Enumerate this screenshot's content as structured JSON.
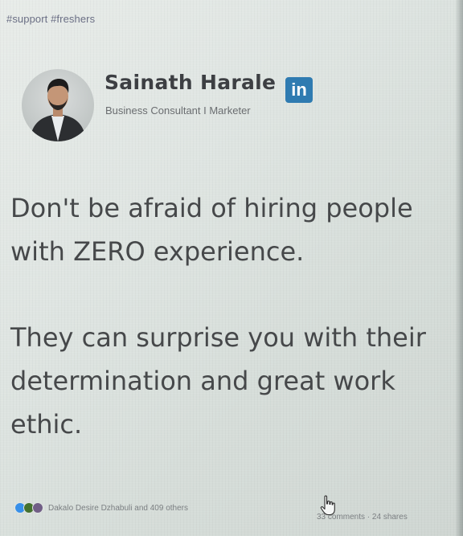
{
  "post": {
    "hashtags": "#support #freshers",
    "author": {
      "name": "Sainath Harale",
      "title": "Business Consultant I Marketer",
      "network_badge": "in"
    },
    "body": {
      "paragraph_1": "Don't be afraid of hiring people with ZERO experience.",
      "paragraph_2": "They can surprise you with their determination and great work ethic."
    },
    "reactions": {
      "icons": [
        "like-icon",
        "celebrate-icon",
        "support-icon"
      ],
      "text": "Dakalo Desire Dzhabuli and 409 others"
    },
    "engagement": {
      "text": "33 comments · 24 shares"
    },
    "colors": {
      "linkedin_blue": "#2f7bb1",
      "like_blue": "#378fe9",
      "celebrate_green": "#44712e",
      "support_purple": "#715e86"
    }
  }
}
